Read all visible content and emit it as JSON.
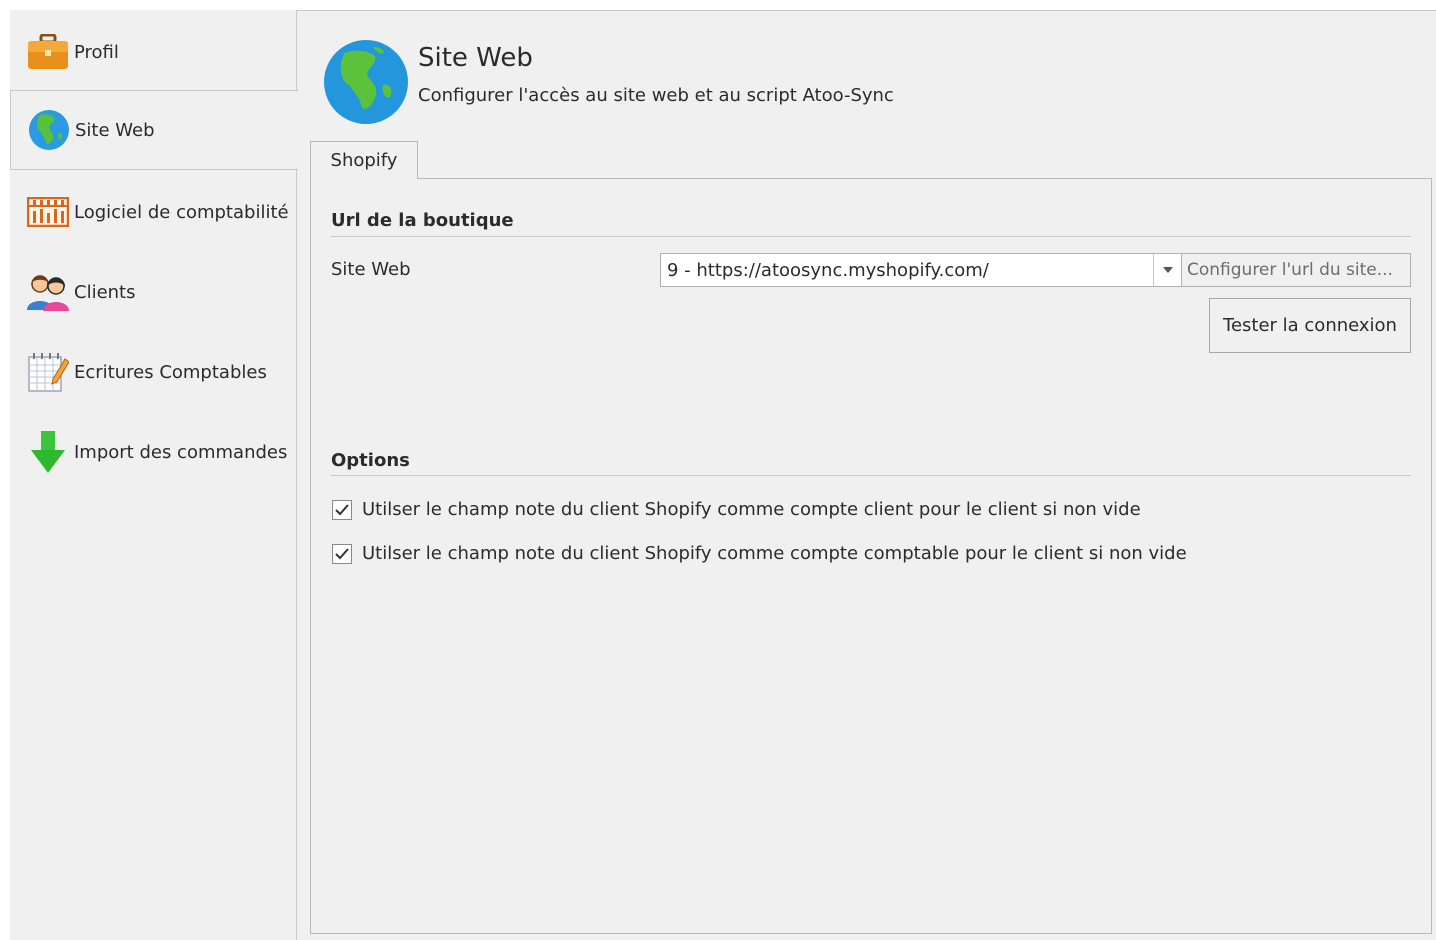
{
  "sidebar": {
    "items": [
      {
        "label": "Profil",
        "icon": "briefcase-icon"
      },
      {
        "label": "Site Web",
        "icon": "globe-icon",
        "active": true
      },
      {
        "label": "Logiciel de comptabilité",
        "icon": "abacus-icon"
      },
      {
        "label": "Clients",
        "icon": "users-icon"
      },
      {
        "label": "Ecritures Comptables",
        "icon": "ledger-edit-icon"
      },
      {
        "label": "Import des commandes",
        "icon": "download-arrow-icon"
      }
    ]
  },
  "header": {
    "title": "Site Web",
    "subtitle": "Configurer l'accès au site web et au script Atoo-Sync",
    "icon": "globe-icon"
  },
  "tabs": [
    {
      "label": "Shopify",
      "active": true
    }
  ],
  "url_section": {
    "title": "Url de la boutique",
    "site_label": "Site Web",
    "site_value": "9 - https://atoosync.myshopify.com/",
    "configure_button": "Configurer l'url du site...",
    "test_button": "Tester la connexion"
  },
  "options_section": {
    "title": "Options",
    "checkboxes": [
      {
        "label": "Utilser le champ note du client Shopify comme compte client pour le client si non vide",
        "checked": true
      },
      {
        "label": "Utilser le champ note du client Shopify comme compte comptable pour le client si non vide",
        "checked": true
      }
    ]
  },
  "colors": {
    "background": "#f0f0f0",
    "border": "#c8c8c8",
    "text": "#2b2b2b",
    "disabled_text": "#6d6d6d"
  }
}
